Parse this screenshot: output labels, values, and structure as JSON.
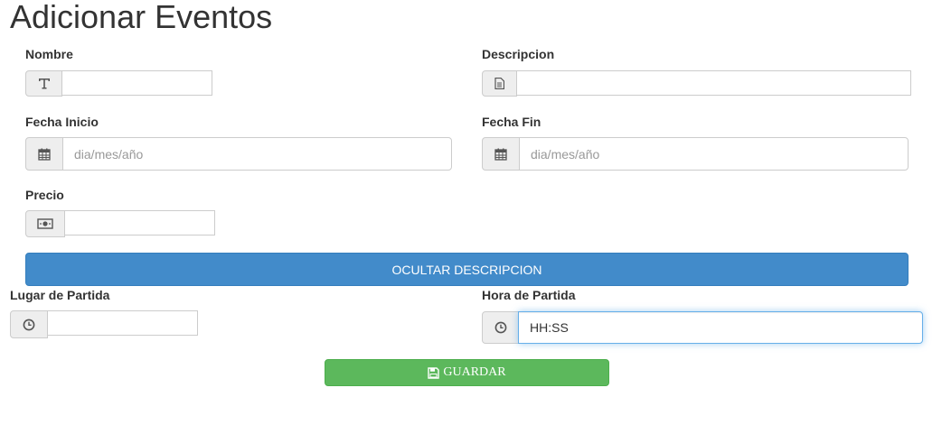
{
  "page": {
    "title": "Adicionar Eventos"
  },
  "form": {
    "nombre": {
      "label": "Nombre",
      "value": "",
      "icon": "text-height-icon"
    },
    "descripcion": {
      "label": "Descripcion",
      "value": "",
      "icon": "file-text-icon"
    },
    "fecha_inicio": {
      "label": "Fecha Inicio",
      "placeholder": "dia/mes/año",
      "icon": "calendar-icon"
    },
    "fecha_fin": {
      "label": "Fecha Fin",
      "placeholder": "dia/mes/año",
      "icon": "calendar-icon"
    },
    "precio": {
      "label": "Precio",
      "value": "",
      "icon": "money-icon"
    },
    "lugar_partida": {
      "label": "Lugar de Partida",
      "value": "",
      "icon": "clock-icon"
    },
    "hora_partida": {
      "label": "Hora de Partida",
      "value": "HH:SS",
      "icon": "clock-icon"
    }
  },
  "buttons": {
    "toggle_description": "OCULTAR DESCRIPCION",
    "save": "GUARDAR",
    "save_icon": "floppy-disk-icon"
  },
  "colors": {
    "primary": "#428bca",
    "success": "#5cb85c",
    "focus_border": "#66afe9",
    "addon_bg": "#eeeeee"
  }
}
